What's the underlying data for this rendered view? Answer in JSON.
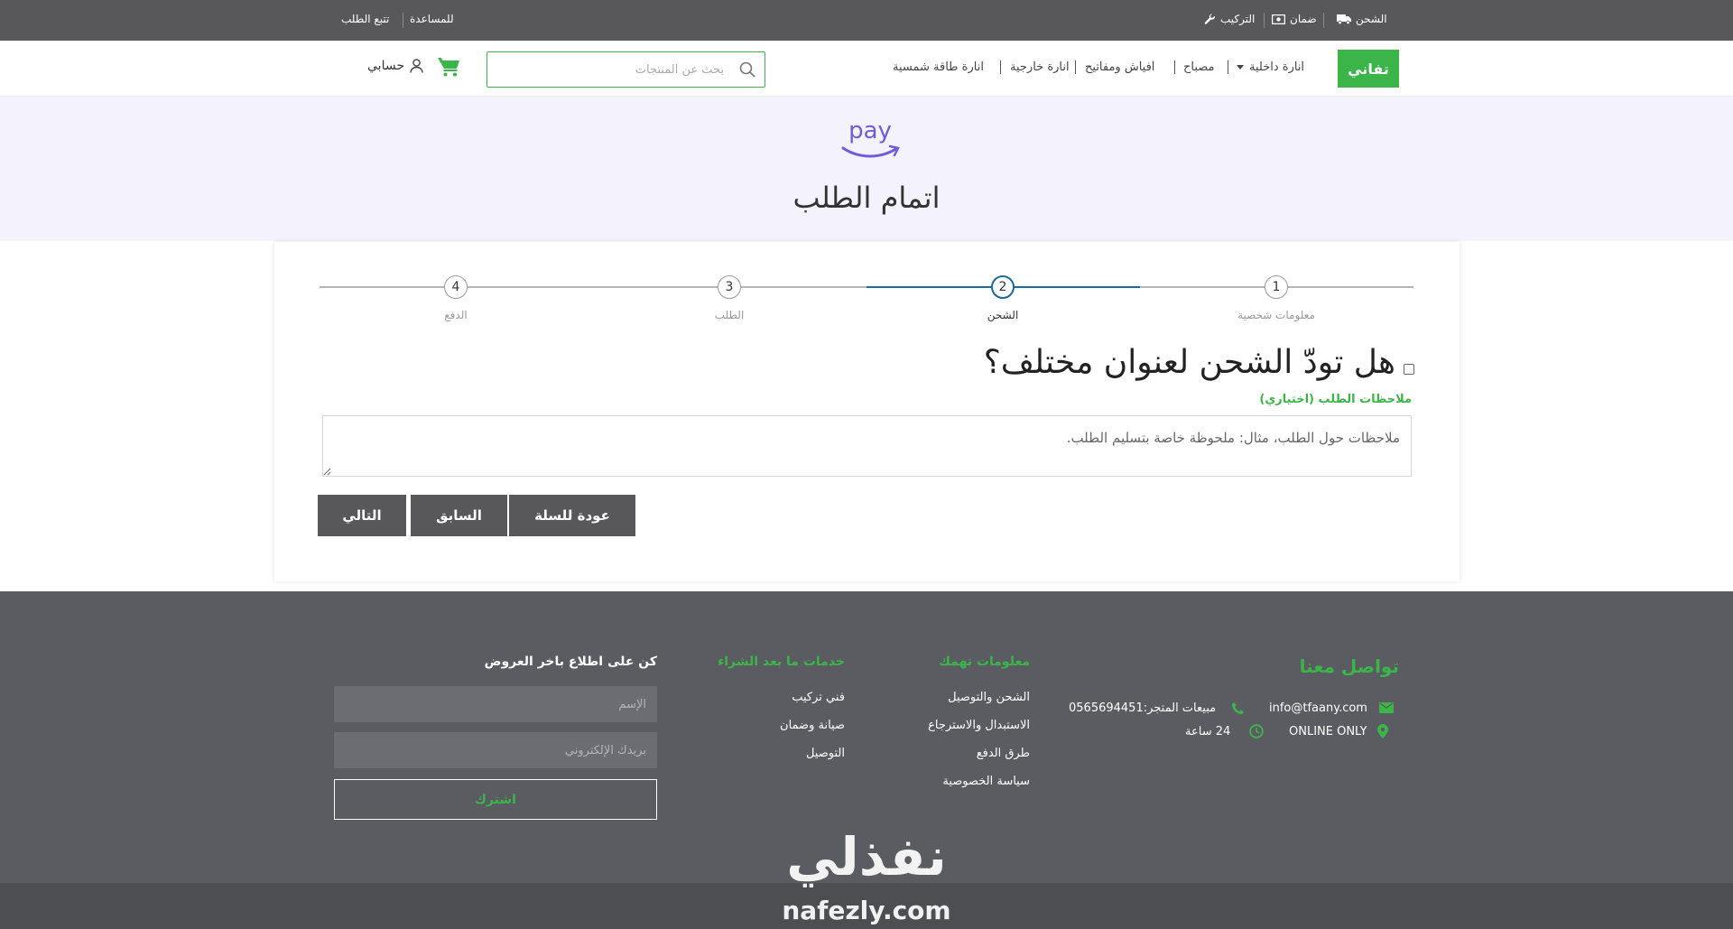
{
  "topbar": {
    "shipping_label": "الشحن",
    "warranty_label": "ضمان",
    "install_label": "التركيب",
    "help_label": "للمساعدة",
    "track_label": "تتبع الطلب"
  },
  "header": {
    "logo_text": "تفاني",
    "nav": [
      "انارة داخلية",
      "مصباح",
      "افياش ومفاتيح",
      "انارة خارجية",
      "انارة طاقة شمسية"
    ],
    "search_placeholder": "بحث عن المنتجات",
    "account_label": "حسابي"
  },
  "hero": {
    "pay_text": "pay",
    "title": "اتمام الطلب"
  },
  "steps": [
    {
      "number": "1",
      "label": "معلومات شخصية"
    },
    {
      "number": "2",
      "label": "الشحن"
    },
    {
      "number": "3",
      "label": "الطلب"
    },
    {
      "number": "4",
      "label": "الدفع"
    }
  ],
  "form": {
    "ship_question": "هل تودّ الشحن لعنوان مختلف؟",
    "notes_label": "ملاحظات الطلب (اختياري)",
    "notes_placeholder": "ملاحظات حول الطلب، مثال: ملحوظة خاصة بتسليم الطلب.",
    "next_button": "التالي",
    "prev_button": "السابق",
    "back_button": "عودة للسلة"
  },
  "footer": {
    "contact_heading": "تواصل معنا",
    "email": "info@tfaany.com",
    "phone": "مبيعات المتجر:0565694451",
    "location": "ONLINE ONLY",
    "hours": "24 ساعة",
    "info_heading": "معلومات تهمك",
    "info_links": [
      "الشحن والتوصيل",
      "الاستبدال والاسترجاع",
      "طرق الدفع",
      "سياسة الخصوصية"
    ],
    "services_heading": "خدمات ما بعد الشراء",
    "services_links": [
      "فني تركيب",
      "صيانة وضمان",
      "التوصيل"
    ],
    "newsletter_heading": "كن على اطلاع باخر العروض",
    "name_placeholder": "الإسم",
    "email_placeholder": "بريدك الإلكتروني",
    "subscribe_button": "اشترك"
  },
  "watermark": {
    "arabic": "نفذلي",
    "latin": "nafezly.com"
  },
  "colors": {
    "accent_green": "#3bb54a",
    "step_active_blue": "#1a6b9e",
    "topbar_gray": "#58585a",
    "footer_gray": "#5a5c61",
    "hero_bg": "#f3f2fd",
    "pay_purple": "#6f5cd8"
  }
}
